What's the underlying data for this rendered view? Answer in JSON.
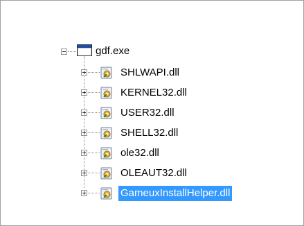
{
  "tree": {
    "root": {
      "label": "gdf.exe",
      "icon": "window-exe-icon",
      "expanded": true
    },
    "children": [
      {
        "label": "SHLWAPI.dll",
        "icon": "dll-module-icon",
        "selected": false
      },
      {
        "label": "KERNEL32.dll",
        "icon": "dll-module-icon",
        "selected": false
      },
      {
        "label": "USER32.dll",
        "icon": "dll-module-icon",
        "selected": false
      },
      {
        "label": "SHELL32.dll",
        "icon": "dll-module-icon",
        "selected": false
      },
      {
        "label": "ole32.dll",
        "icon": "dll-module-icon",
        "selected": false
      },
      {
        "label": "OLEAUT32.dll",
        "icon": "dll-module-icon",
        "selected": false
      },
      {
        "label": "GameuxInstallHelper.dll",
        "icon": "dll-module-icon",
        "selected": true
      }
    ],
    "selection_color": "#3399ff"
  }
}
